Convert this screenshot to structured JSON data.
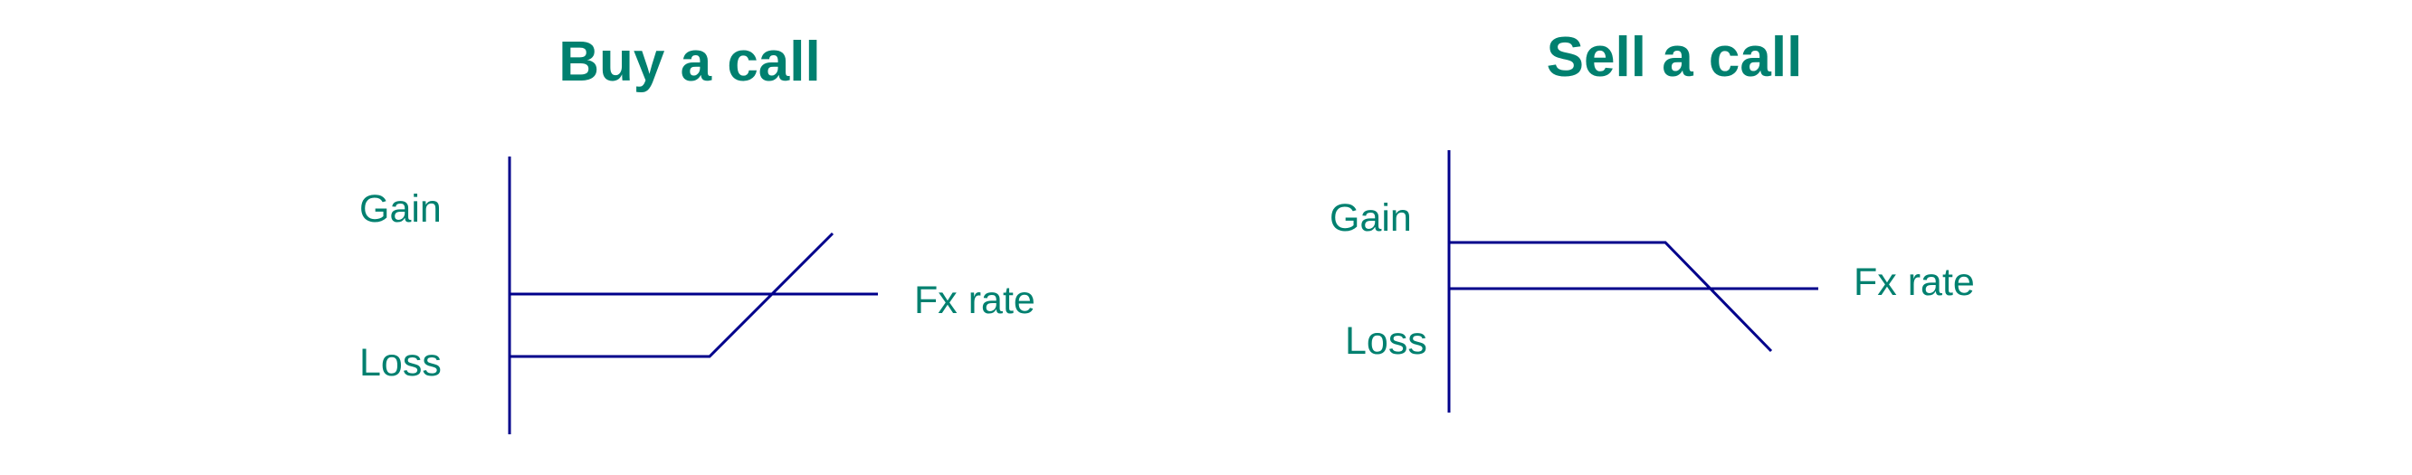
{
  "colors": {
    "text": "#00806F",
    "line": "#00008B",
    "background": "#FFFFFF"
  },
  "diagrams": [
    {
      "title": "Buy a call",
      "y_labels": {
        "top": "Gain",
        "bottom": "Loss"
      },
      "x_label": "Fx rate",
      "payoff_shape": "flat-loss-then-rising"
    },
    {
      "title": "Sell a call",
      "y_labels": {
        "top": "Gain",
        "bottom": "Loss"
      },
      "x_label": "Fx rate",
      "payoff_shape": "flat-gain-then-falling"
    }
  ]
}
